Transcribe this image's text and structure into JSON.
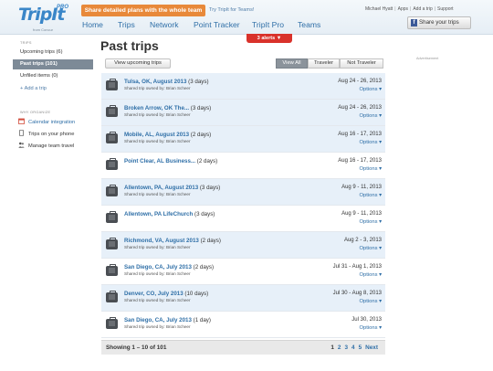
{
  "header": {
    "logo_text": "TripIt",
    "logo_pro": "PRO",
    "logo_sub": "from Concur",
    "promo_button": "Share detailed plans with the whole team",
    "promo_link": "Try TripIt for Teams!",
    "user_name": "Michael Hyatt",
    "user_links": [
      "Apps",
      "Add a trip",
      "Support"
    ],
    "nav_tabs": [
      "Home",
      "Trips",
      "Network",
      "Point Tracker",
      "TripIt Pro",
      "Teams"
    ],
    "alerts": "3 alerts ▼",
    "share_button": "Share your trips",
    "share_icon": "facebook-icon"
  },
  "sidebar": {
    "trips_label": "TRIPS",
    "items": [
      {
        "label": "Upcoming trips (6)",
        "active": false
      },
      {
        "label": "Past trips (101)",
        "active": true
      },
      {
        "label": "Unfiled items (0)",
        "active": false
      }
    ],
    "add_trip": "+ Add a trip",
    "organize_label": "WHY ORGANIZE",
    "links": [
      {
        "label": "Calendar integration",
        "icon": "calendar-icon"
      },
      {
        "label": "Trips on your phone",
        "icon": "phone-icon"
      },
      {
        "label": "Manage team travel",
        "icon": "people-icon"
      }
    ]
  },
  "main": {
    "title": "Past trips",
    "view_upcoming": "View upcoming trips",
    "filters": [
      "View All",
      "Traveler",
      "Not Traveler"
    ],
    "active_filter": "View All",
    "ad_label": "Advertisement",
    "trips": [
      {
        "name": "Tulsa, OK, August 2013",
        "duration": "(3 days)",
        "owner": "Shared trip owned by: Brian Scheer",
        "dates": "Aug 24 - 26, 2013",
        "options": "Options ▾"
      },
      {
        "name": "Broken Arrow, OK The...",
        "duration": "(3 days)",
        "owner": "Shared trip owned by: Brian Scheer",
        "dates": "Aug 24 - 26, 2013",
        "options": "Options ▾"
      },
      {
        "name": "Mobile, AL, August 2013",
        "duration": "(2 days)",
        "owner": "Shared trip owned by: Brian Scheer",
        "dates": "Aug 16 - 17, 2013",
        "options": "Options ▾"
      },
      {
        "name": "Point Clear, AL Business...",
        "duration": "(2 days)",
        "owner": "",
        "dates": "Aug 16 - 17, 2013",
        "options": "Options ▾"
      },
      {
        "name": "Allentown, PA, August 2013",
        "duration": "(3 days)",
        "owner": "Shared trip owned by: Brian Scheer",
        "dates": "Aug 9 - 11, 2013",
        "options": "Options ▾"
      },
      {
        "name": "Allentown, PA LifeChurch",
        "duration": "(3 days)",
        "owner": "",
        "dates": "Aug 9 - 11, 2013",
        "options": "Options ▾"
      },
      {
        "name": "Richmond, VA, August 2013",
        "duration": "(2 days)",
        "owner": "Shared trip owned by: Brian Scheer",
        "dates": "Aug 2 - 3, 2013",
        "options": "Options ▾"
      },
      {
        "name": "San Diego, CA, July 2013",
        "duration": "(2 days)",
        "owner": "Shared trip owned by: Brian Scheer",
        "dates": "Jul 31 - Aug 1, 2013",
        "options": "Options ▾"
      },
      {
        "name": "Denver, CO, July 2013",
        "duration": "(10 days)",
        "owner": "Shared trip owned by: Brian Scheer",
        "dates": "Jul 30 - Aug 8, 2013",
        "options": "Options ▾"
      },
      {
        "name": "San Diego, CA, July 2013",
        "duration": "(1 day)",
        "owner": "Shared trip owned by: Brian Scheer",
        "dates": "Jul 30, 2013",
        "options": "Options ▾"
      }
    ],
    "showing": "Showing 1 – 10 of 101",
    "pages": [
      "1",
      "2",
      "3",
      "4",
      "5"
    ],
    "current_page": "1",
    "next": "Next"
  }
}
